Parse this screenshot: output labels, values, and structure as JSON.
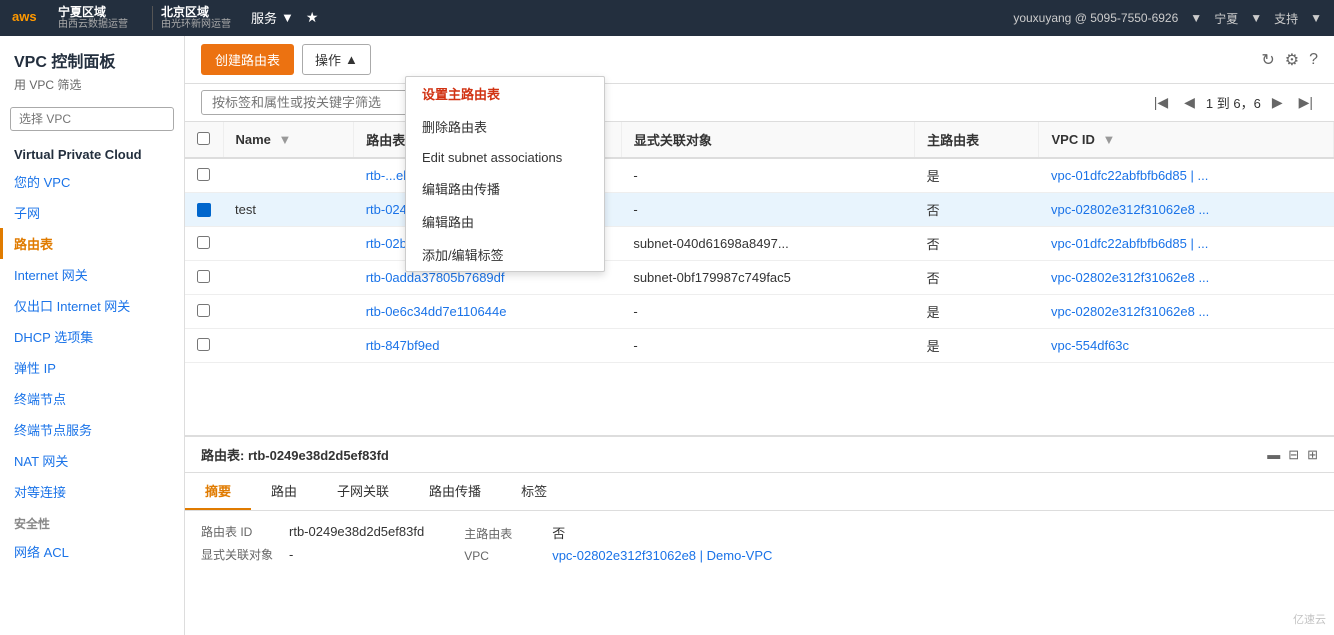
{
  "navbar": {
    "region1_main": "宁夏区域",
    "region1_sub": "由西云数据运营",
    "region2_main": "北京区域",
    "region2_sub": "由光环新网运营",
    "services_label": "服务",
    "user_info": "youxuyang @ 5095-7550-6926",
    "region_label": "宁夏",
    "support_label": "支持"
  },
  "sidebar": {
    "title": "VPC 控制面板",
    "subtitle": "用 VPC 筛选",
    "filter_placeholder": "选择 VPC",
    "section1": "Virtual Private Cloud",
    "items": [
      {
        "label": "您的 VPC",
        "active": false
      },
      {
        "label": "子网",
        "active": false
      },
      {
        "label": "路由表",
        "active": true
      },
      {
        "label": "Internet 网关",
        "active": false
      },
      {
        "label": "仅出口 Internet 网关",
        "active": false
      },
      {
        "label": "DHCP 选项集",
        "active": false
      },
      {
        "label": "弹性 IP",
        "active": false
      },
      {
        "label": "终端节点",
        "active": false
      },
      {
        "label": "终端节点服务",
        "active": false
      },
      {
        "label": "NAT 网关",
        "active": false
      },
      {
        "label": "对等连接",
        "active": false
      }
    ],
    "section2": "安全性",
    "security_items": [
      {
        "label": "网络 ACL",
        "active": false
      }
    ]
  },
  "toolbar": {
    "create_label": "创建路由表",
    "actions_label": "操作",
    "refresh_icon": "↻",
    "settings_icon": "⚙",
    "help_icon": "?"
  },
  "dropdown": {
    "items": [
      {
        "label": "设置主路由表",
        "highlighted": true
      },
      {
        "label": "删除路由表",
        "highlighted": false
      },
      {
        "label": "Edit subnet associations",
        "highlighted": false
      },
      {
        "label": "编辑路由传播",
        "highlighted": false
      },
      {
        "label": "编辑路由",
        "highlighted": false
      },
      {
        "label": "添加/编辑标签",
        "highlighted": false
      }
    ]
  },
  "search": {
    "placeholder": "按标签和属性或按关键字筛选"
  },
  "pagination": {
    "info": "1 到 6，6",
    "page": "1"
  },
  "table": {
    "columns": [
      "Name",
      "路由表 ID",
      "显式关联对象",
      "主路由表",
      "VPC ID"
    ],
    "rows": [
      {
        "name": "",
        "id": "rtb-...ebc",
        "id_full": "rtb-...ebc",
        "assoc": "-",
        "main": "是",
        "vpc": "vpc-01dfc22abfbfb6d85 | ...",
        "selected": false
      },
      {
        "name": "test",
        "id": "rtb-0249e38d2d5ef83fd",
        "id_full": "rtb-0249e38d2d5ef83fd",
        "assoc": "-",
        "main": "否",
        "vpc": "vpc-02802e312f31062e8 ...",
        "selected": true
      },
      {
        "name": "",
        "id": "rtb-02b8cb47e3e6bb437",
        "assoc": "subnet-040d61698a8497...",
        "main": "否",
        "vpc": "vpc-01dfc22abfbfb6d85 | ...",
        "selected": false
      },
      {
        "name": "",
        "id": "rtb-0adda37805b7689df",
        "assoc": "subnet-0bf179987c749fac5",
        "main": "否",
        "vpc": "vpc-02802e312f31062e8 ...",
        "selected": false
      },
      {
        "name": "",
        "id": "rtb-0e6c34dd7e110644e",
        "assoc": "-",
        "main": "是",
        "vpc": "vpc-02802e312f31062e8 ...",
        "selected": false
      },
      {
        "name": "",
        "id": "rtb-847bf9ed",
        "assoc": "-",
        "main": "是",
        "vpc": "vpc-554df63c",
        "selected": false
      }
    ]
  },
  "detail": {
    "header": "路由表: rtb-0249e38d2d5ef83fd",
    "tabs": [
      "摘要",
      "路由",
      "子网关联",
      "路由传播",
      "标签"
    ],
    "active_tab": "摘要",
    "fields_left": [
      {
        "label": "路由表 ID",
        "value": "rtb-0249e38d2d5ef83fd"
      },
      {
        "label": "显式关联对象",
        "value": "-"
      }
    ],
    "fields_right": [
      {
        "label": "主路由表",
        "value": "否"
      },
      {
        "label": "VPC",
        "value": "vpc-02802e312f31062e8 | Demo-VPC",
        "link": true
      }
    ]
  },
  "watermark": "亿速云"
}
